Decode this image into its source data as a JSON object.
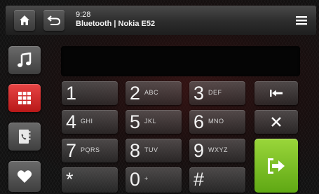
{
  "status": {
    "time": "9:28",
    "connection": "Bluetooth | Nokia E52"
  },
  "topbar": {
    "home_icon": "home-icon",
    "back_icon": "back-arrow-icon",
    "menu_icon": "menu-icon"
  },
  "sidebar": {
    "items": [
      {
        "name": "music",
        "icon": "music-note-icon",
        "active": false
      },
      {
        "name": "keypad",
        "icon": "keypad-grid-icon",
        "active": true
      },
      {
        "name": "contacts",
        "icon": "contacts-book-icon",
        "active": false
      },
      {
        "name": "favorites",
        "icon": "heart-icon",
        "active": false
      }
    ]
  },
  "display": {
    "number": ""
  },
  "keys": [
    {
      "digit": "1",
      "letters": ""
    },
    {
      "digit": "2",
      "letters": "ABC"
    },
    {
      "digit": "3",
      "letters": "DEF"
    },
    {
      "digit": "4",
      "letters": "GHI"
    },
    {
      "digit": "5",
      "letters": "JKL"
    },
    {
      "digit": "6",
      "letters": "MNO"
    },
    {
      "digit": "7",
      "letters": "PQRS"
    },
    {
      "digit": "8",
      "letters": "TUV"
    },
    {
      "digit": "9",
      "letters": "WXYZ"
    },
    {
      "digit": "*",
      "letters": ""
    },
    {
      "digit": "0",
      "letters": "+"
    },
    {
      "digit": "#",
      "letters": ""
    }
  ],
  "actions": {
    "backspace_icon": "backspace-icon",
    "clear_icon": "clear-x-icon",
    "call_icon": "call-icon"
  },
  "colors": {
    "active": "#d82a2a",
    "call": "#7cc02a",
    "panel": "#2e2e2e"
  }
}
